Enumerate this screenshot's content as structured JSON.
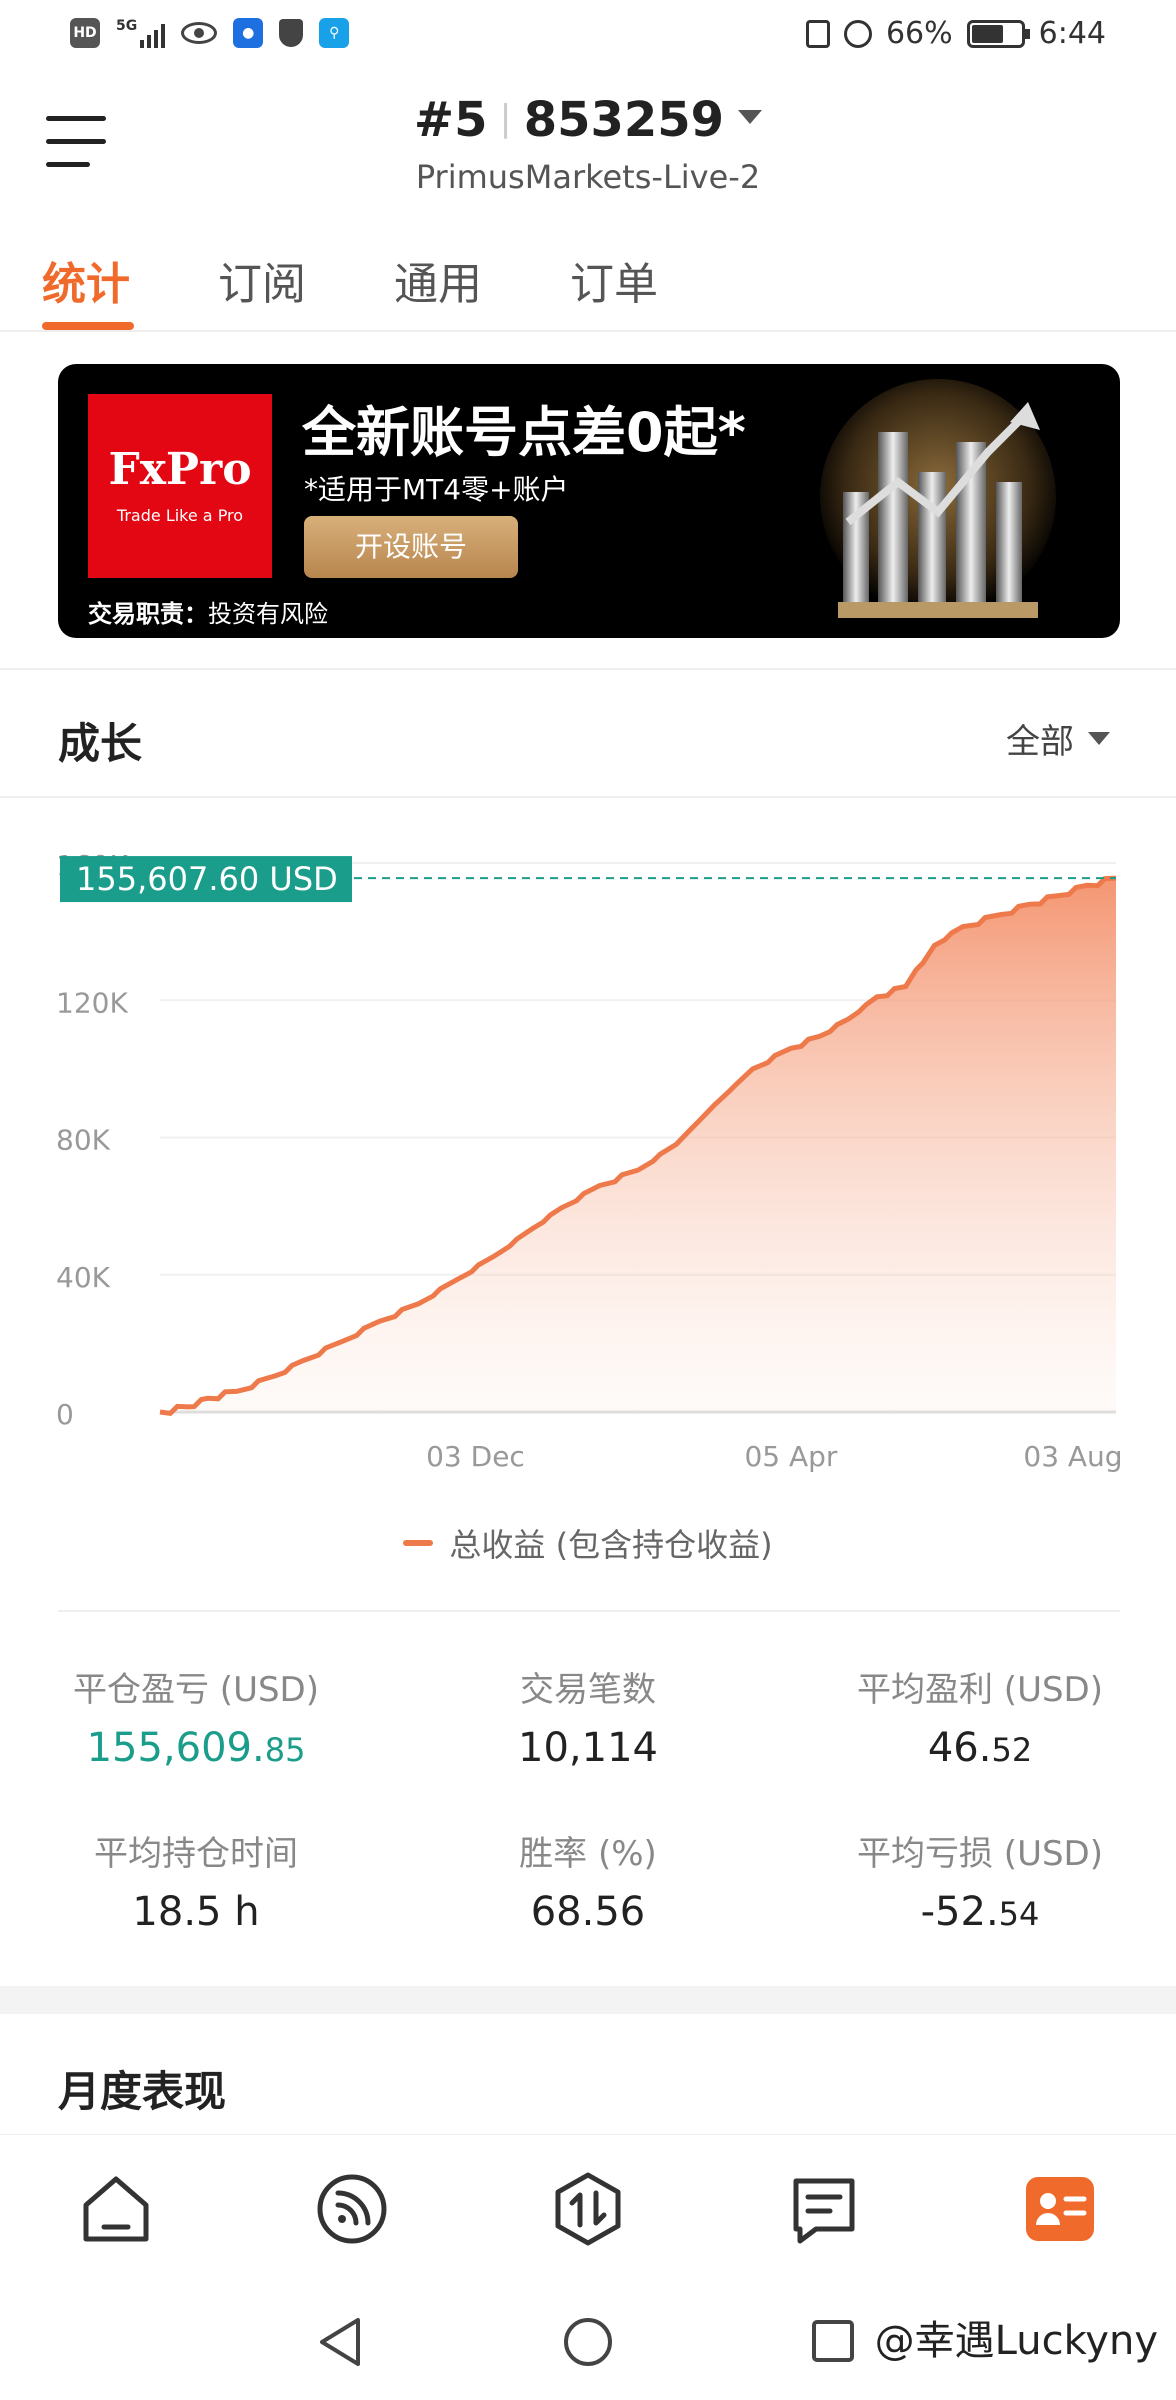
{
  "status_bar": {
    "left_icons": [
      "hd-icon",
      "signal-5g-icon",
      "eye-icon",
      "lightbulb-app-icon",
      "shield-icon",
      "search-app-icon"
    ],
    "network": "5G",
    "battery_pct": "66%",
    "battery_level": 0.66,
    "time": "6:44"
  },
  "header": {
    "account_number": "#5",
    "account_id": "853259",
    "server": "PrimusMarkets-Live-2"
  },
  "tabs": [
    {
      "label": "统计",
      "active": true
    },
    {
      "label": "订阅",
      "active": false
    },
    {
      "label": "通用",
      "active": false
    },
    {
      "label": "订单",
      "active": false
    }
  ],
  "banner": {
    "logo_brand": "FxPro",
    "logo_tagline": "Trade Like a Pro",
    "headline": "全新账号点差0起*",
    "subline": "*适用于MT4零+账户",
    "cta": "开设账号",
    "risk_label": "交易职责：",
    "risk_text": "投资有风险"
  },
  "growth": {
    "title": "成长",
    "range": "全部"
  },
  "chart_data": {
    "type": "area",
    "series": [
      {
        "name": "总收益 (包含持仓收益)",
        "color": "#ee7a4c",
        "x": [
          0,
          0.03,
          0.05,
          0.08,
          0.12,
          0.15,
          0.19,
          0.23,
          0.27,
          0.31,
          0.35,
          0.39,
          0.42,
          0.46,
          0.5,
          0.54,
          0.58,
          0.62,
          0.66,
          0.69,
          0.72,
          0.75,
          0.78,
          0.81,
          0.84,
          0.88,
          0.91,
          0.94,
          0.97,
          1.0
        ],
        "values": [
          0,
          1500,
          4000,
          6000,
          10500,
          15000,
          20500,
          26500,
          31500,
          38500,
          45500,
          53500,
          59500,
          66000,
          70500,
          78000,
          89500,
          100000,
          106000,
          109500,
          114500,
          121000,
          124000,
          136000,
          141500,
          145000,
          148000,
          150500,
          153500,
          155607.6
        ]
      }
    ],
    "x_ticks": [
      "03 Dec",
      "05 Apr",
      "03 Aug"
    ],
    "y_ticks": [
      "0",
      "40K",
      "80K",
      "120K",
      "160K"
    ],
    "ylim": [
      0,
      160000
    ],
    "current_value_label": "155,607.60 USD",
    "grid": true,
    "legend_position": "bottom"
  },
  "stats": [
    {
      "label": "平仓盈亏 (USD)",
      "value_int": "155,609.",
      "value_dec": "85",
      "highlight": true
    },
    {
      "label": "交易笔数",
      "value_int": "10,114",
      "value_dec": "",
      "highlight": false
    },
    {
      "label": "平均盈利 (USD)",
      "value_int": "46.",
      "value_dec": "52",
      "highlight": false
    },
    {
      "label": "平均持仓时间",
      "value_int": "18.5 h",
      "value_dec": "",
      "highlight": false
    },
    {
      "label": "胜率 (%)",
      "value_int": "68.56",
      "value_dec": "",
      "highlight": false
    },
    {
      "label": "平均亏损 (USD)",
      "value_int": "-52.",
      "value_dec": "54",
      "highlight": false
    }
  ],
  "monthly": {
    "title": "月度表现"
  },
  "bottom_nav": [
    "home-icon",
    "signals-icon",
    "trade-icon",
    "messages-icon",
    "profile-icon"
  ],
  "watermark": "@幸遇Luckyny",
  "colors": {
    "accent": "#f06a2b",
    "green": "#1a9d8a",
    "chart_line": "#ee7a4c"
  }
}
